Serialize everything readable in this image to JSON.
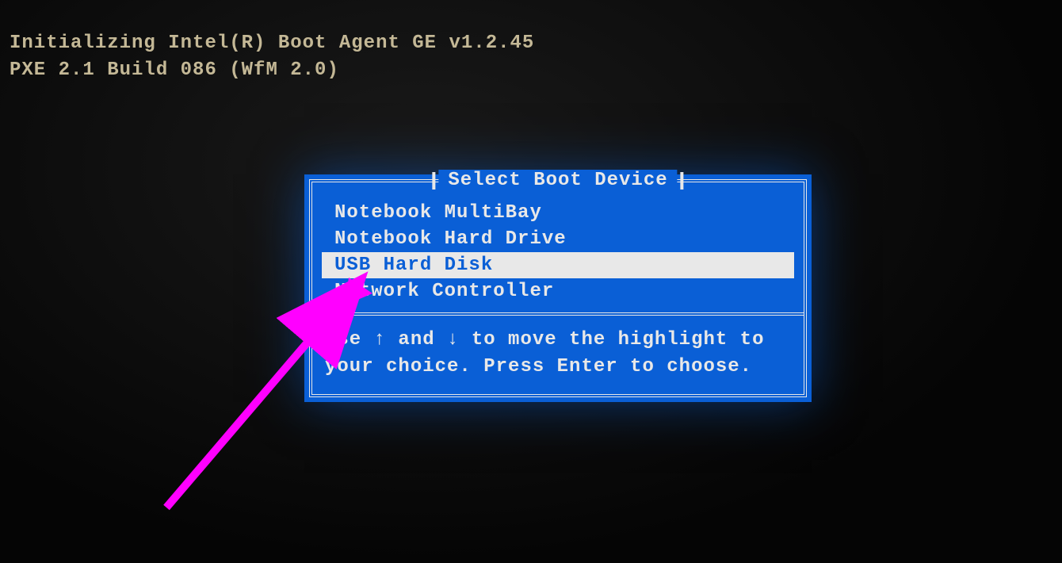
{
  "boot": {
    "line1": "Initializing Intel(R) Boot Agent GE v1.2.45",
    "line2": "PXE 2.1 Build 086 (WfM 2.0)"
  },
  "menu": {
    "title": "Select Boot Device",
    "items": [
      {
        "label": "Notebook MultiBay",
        "selected": false
      },
      {
        "label": "Notebook Hard Drive",
        "selected": false
      },
      {
        "label": "USB Hard Disk",
        "selected": true
      },
      {
        "label": "Network Controller",
        "selected": false
      }
    ],
    "instructions": "Use ↑ and ↓ to move the highlight to your choice.  Press Enter to choose."
  },
  "annotation": {
    "arrow_color": "#ff00ff"
  }
}
